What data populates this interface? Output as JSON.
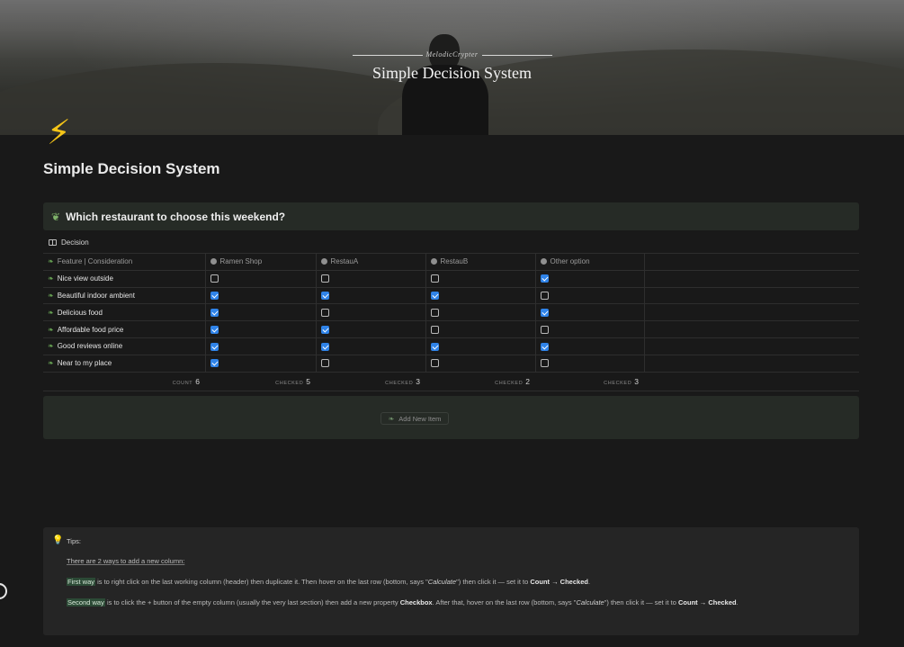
{
  "cover": {
    "subtitle": "MelodicCrypter",
    "title": "Simple Decision System"
  },
  "page": {
    "icon": "lightning-icon",
    "title": "Simple Decision System"
  },
  "question": {
    "icon": "leaves-icon",
    "text": "Which restaurant to choose this weekend?"
  },
  "database": {
    "title": "Decision",
    "columns": [
      "Feature | Consideration",
      "Ramen Shop",
      "RestauA",
      "RestauB",
      "Other option"
    ],
    "rows": [
      {
        "label": "Nice view outside",
        "checks": [
          false,
          false,
          false,
          true
        ]
      },
      {
        "label": "Beautiful indoor ambient",
        "checks": [
          true,
          true,
          true,
          false
        ]
      },
      {
        "label": "Delicious food",
        "checks": [
          true,
          false,
          false,
          true
        ]
      },
      {
        "label": "Affordable food price",
        "checks": [
          true,
          true,
          false,
          false
        ]
      },
      {
        "label": "Good reviews online",
        "checks": [
          true,
          true,
          true,
          true
        ]
      },
      {
        "label": "Near to my place",
        "checks": [
          true,
          false,
          false,
          false
        ]
      }
    ],
    "calc": [
      {
        "label": "COUNT",
        "value": "6"
      },
      {
        "label": "CHECKED",
        "value": "5"
      },
      {
        "label": "CHECKED",
        "value": "3"
      },
      {
        "label": "CHECKED",
        "value": "2"
      },
      {
        "label": "CHECKED",
        "value": "3"
      }
    ],
    "checkbox_color": "#2f83e8"
  },
  "add_item": {
    "label": "Add New Item"
  },
  "tips": {
    "heading": "Tips:",
    "intro": "There are 2 ways to add a new column:",
    "first": {
      "hl": "First way",
      "t1": " is to right click on the last working column (header) then duplicate it. Then hover on the last row (bottom, says \"",
      "calc": "Calculate",
      "t2": "\") then click it — set it to ",
      "bold": "Count → Checked",
      "end": "."
    },
    "second": {
      "hl": "Second way",
      "t1": " is to click the + button of the empty column (usually the very last section) then add a new property ",
      "bold1": "Checkbox",
      "t2": ". After that, hover on the last row (bottom, says \"",
      "calc": "Calculate",
      "t3": "\") then click it — set it to ",
      "bold2": "Count → Checked",
      "end": "."
    }
  }
}
